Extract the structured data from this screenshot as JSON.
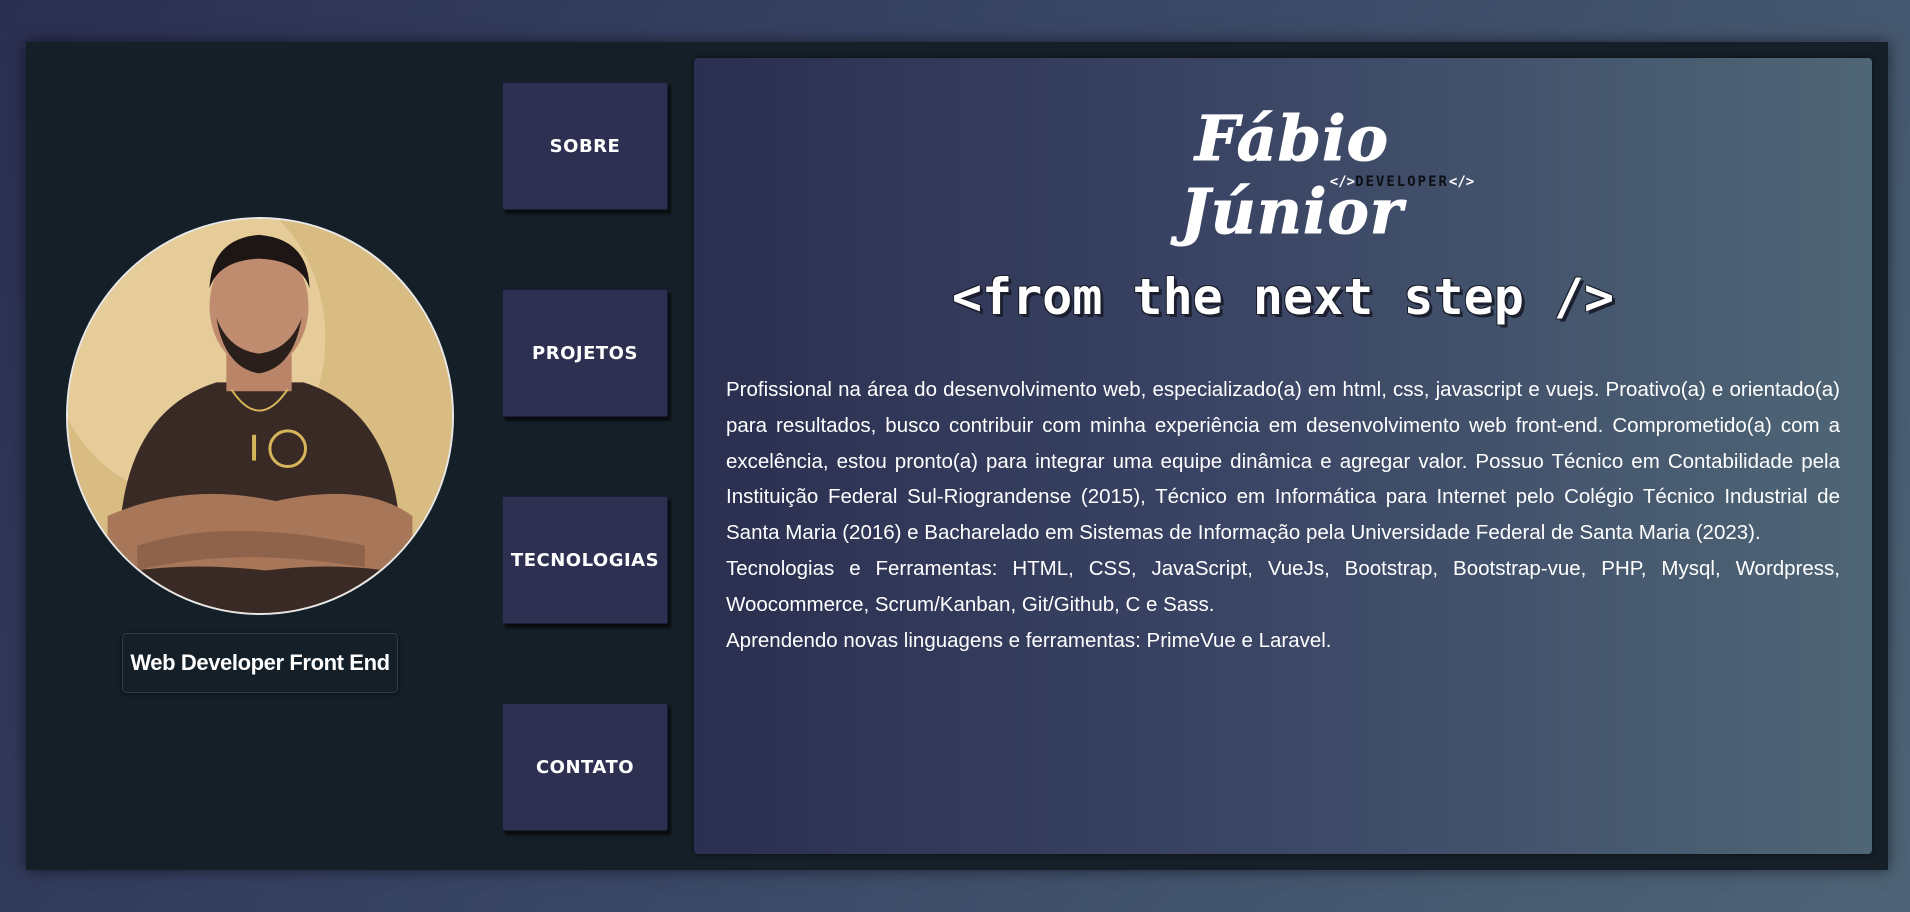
{
  "sidebar": {
    "role_label": "Web Developer Front End"
  },
  "nav": {
    "items": [
      {
        "label": "SOBRE"
      },
      {
        "label": "PROJETOS"
      },
      {
        "label": "TECNOLOGIAS"
      },
      {
        "label": "CONTATO"
      }
    ]
  },
  "header": {
    "logo_name": "Fábio Júnior",
    "logo_tag_open": "</>",
    "logo_subtitle": "DEVELOPER",
    "logo_tag_close": "</>"
  },
  "main": {
    "tagline": "<from the next step />",
    "bio_paragraphs": [
      "Profissional na área do desenvolvimento web, especializado(a) em html, css, javascript e vuejs. Proativo(a) e orientado(a) para resultados, busco contribuir com minha experiência em desenvolvimento web front-end. Comprometido(a) com a excelência, estou pronto(a) para integrar uma equipe dinâmica e agregar valor. Possuo Técnico em Contabilidade pela Instituição Federal Sul-Riograndense (2015), Técnico em Informática para Internet pelo Colégio Técnico Industrial de Santa Maria (2016) e Bacharelado em Sistemas de Informação pela Universidade Federal de Santa Maria (2023).",
      "Tecnologias e Ferramentas: HTML, CSS, JavaScript, VueJs, Bootstrap, Bootstrap-vue, PHP, Mysql, Wordpress, Woocommerce, Scrum/Kanban, Git/Github, C e Sass.",
      "Aprendendo novas linguagens e ferramentas: PrimeVue e Laravel."
    ]
  },
  "colors": {
    "frame_bg": "#151f27",
    "nav_button_bg": "#2d3050",
    "text": "#ffffff"
  }
}
